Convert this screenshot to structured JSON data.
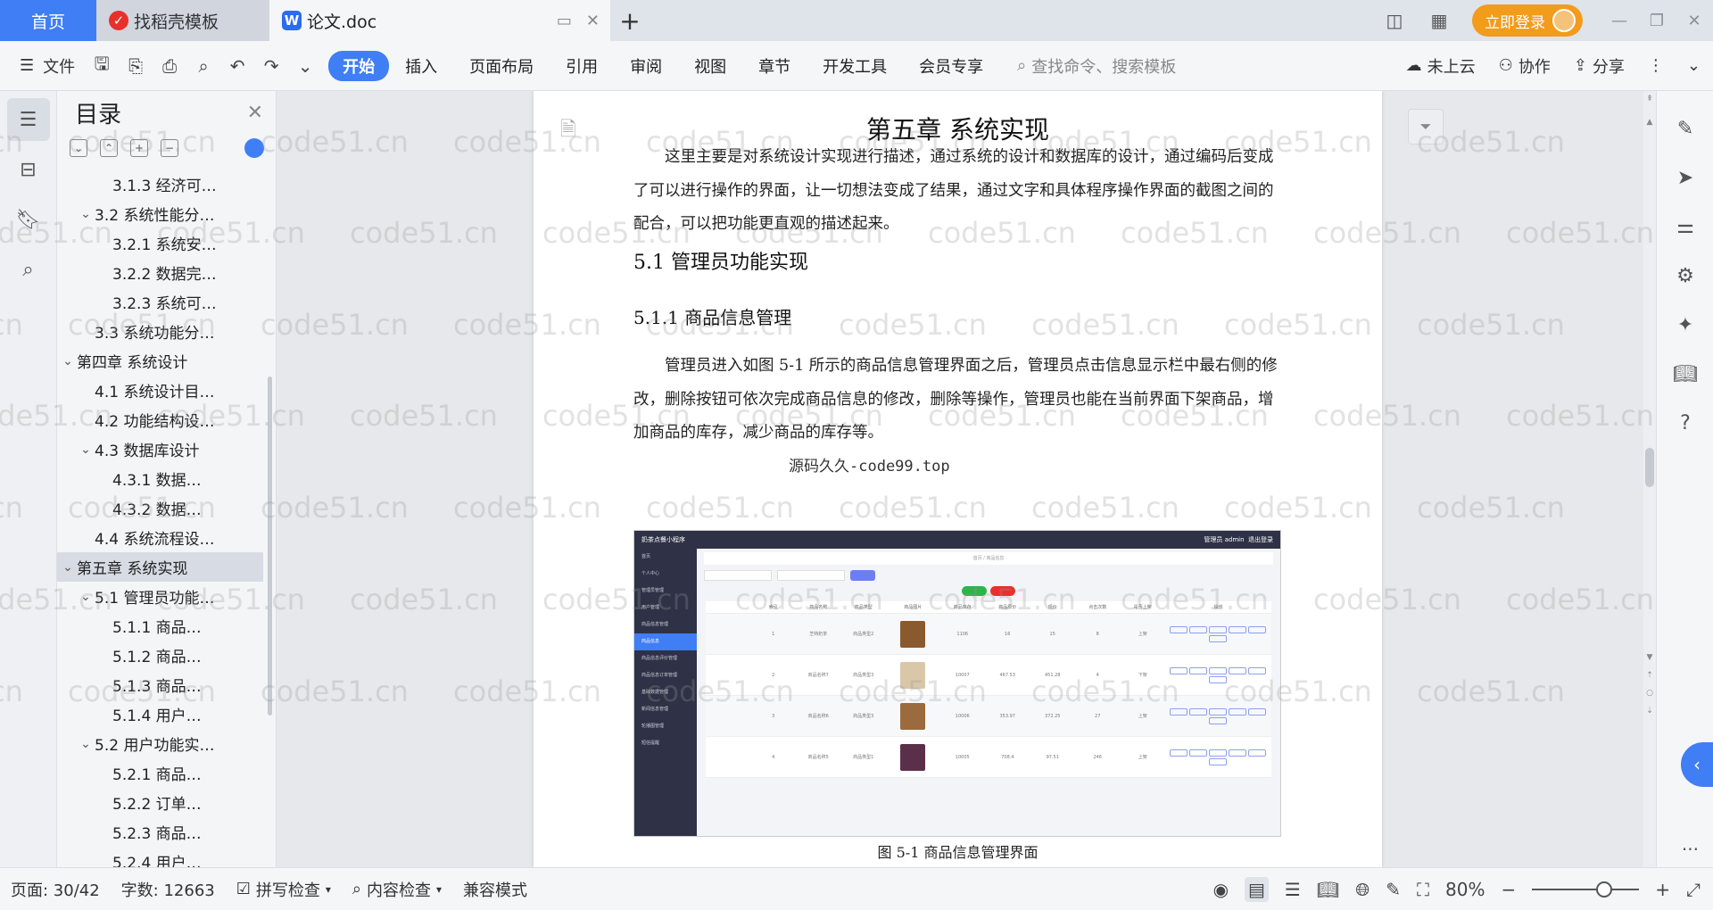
{
  "tabs": {
    "home": "首页",
    "docer": "找稻壳模板",
    "doc": "论文.doc",
    "add": "+"
  },
  "title_right": {
    "login": "立即登录"
  },
  "ribbon": {
    "file": "文件",
    "menus": [
      "开始",
      "插入",
      "页面布局",
      "引用",
      "审阅",
      "视图",
      "章节",
      "开发工具",
      "会员专享"
    ],
    "search_placeholder": "查找命令、搜索模板",
    "cloud": "未上云",
    "collab": "协作",
    "share": "分享"
  },
  "toc": {
    "title": "目录",
    "items": [
      {
        "label": "3.1.3 经济可…",
        "level": 3
      },
      {
        "label": "3.2 系统性能分…",
        "level": 2,
        "arrow": "v"
      },
      {
        "label": "3.2.1 系统安…",
        "level": 3
      },
      {
        "label": "3.2.2 数据完…",
        "level": 3
      },
      {
        "label": "3.2.3 系统可…",
        "level": 3
      },
      {
        "label": "3.3 系统功能分…",
        "level": 2
      },
      {
        "label": "第四章 系统设计",
        "level": 1,
        "arrow": "v"
      },
      {
        "label": "4.1 系统设计目…",
        "level": 2
      },
      {
        "label": "4.2 功能结构设…",
        "level": 2
      },
      {
        "label": "4.3 数据库设计",
        "level": 2,
        "arrow": "v"
      },
      {
        "label": "4.3.1 数据…",
        "level": 3
      },
      {
        "label": "4.3.2 数据…",
        "level": 3
      },
      {
        "label": "4.4 系统流程设…",
        "level": 2
      },
      {
        "label": "第五章 系统实现",
        "level": 1,
        "arrow": "v",
        "selected": true
      },
      {
        "label": "5.1 管理员功能…",
        "level": 2,
        "arrow": "v"
      },
      {
        "label": "5.1.1 商品…",
        "level": 3
      },
      {
        "label": "5.1.2 商品…",
        "level": 3
      },
      {
        "label": "5.1.3 商品…",
        "level": 3
      },
      {
        "label": "5.1.4 用户…",
        "level": 3
      },
      {
        "label": "5.2 用户功能实…",
        "level": 2,
        "arrow": "v"
      },
      {
        "label": "5.2.1 商品…",
        "level": 3
      },
      {
        "label": "5.2.2 订单…",
        "level": 3
      },
      {
        "label": "5.2.3 商品…",
        "level": 3
      },
      {
        "label": "5.2.4 用户…",
        "level": 3
      }
    ]
  },
  "document": {
    "chapter_title": "第五章  系统实现",
    "intro": "这里主要是对系统设计实现进行描述，通过系统的设计和数据库的设计，通过编码后变成了可以进行操作的界面，让一切想法变成了结果，通过文字和具体程序操作界面的截图之间的配合，可以把功能更直观的描述起来。",
    "h2": "5.1 管理员功能实现",
    "h3": "5.1.1  商品信息管理",
    "body": "管理员进入如图 5-1 所示的商品信息管理界面之后，管理员点击信息显示栏中最右侧的修改，删除按钮可依次完成商品信息的修改，删除等操作，管理员也能在当前界面下架商品，增加商品的库存，减少商品的库存等。",
    "overlay_watermark": "源码久久-code99.top",
    "caption": "图 5-1  商品信息管理界面"
  },
  "embedded_screenshot": {
    "app_title": "奶茶点餐小程序",
    "admin": "管理员 admin",
    "logout": "退出登录",
    "crumb": "首页 / 商品信息",
    "side_items": [
      "首页",
      "个人中心",
      "管理员管理",
      "用户管理",
      "商品信息管理",
      "商品信息",
      "商品信息评价管理",
      "商品信息订单管理",
      "基础数据管理",
      "新闻信息管理",
      "轮播图管理",
      "短信提醒"
    ],
    "side_active_index": 5,
    "headers": [
      "",
      "索引",
      "商品名称",
      "商品类型",
      "商品图片",
      "商品库存",
      "商品原价",
      "现价",
      "点击次数",
      "是否上架",
      "操作"
    ],
    "rows": [
      {
        "idx": "1",
        "name": "芝特奶茶",
        "type": "商品类型2",
        "stock": "1106",
        "price": "16",
        "now": "15",
        "clicks": "8",
        "status": "上架",
        "color": "#8a5a2f"
      },
      {
        "idx": "2",
        "name": "商品名称7",
        "type": "商品类型3",
        "stock": "10007",
        "price": "467.53",
        "now": "451.28",
        "clicks": "4",
        "status": "下架",
        "color": "#d9c7a8"
      },
      {
        "idx": "3",
        "name": "商品名称6",
        "type": "商品类型3",
        "stock": "10006",
        "price": "353.97",
        "now": "372.25",
        "clicks": "27",
        "status": "上架",
        "color": "#9b6a3d"
      },
      {
        "idx": "4",
        "name": "商品名称5",
        "type": "商品类型1",
        "stock": "10005",
        "price": "708.4",
        "now": "97.51",
        "clicks": "246",
        "status": "上架",
        "color": "#5b2f4a"
      }
    ]
  },
  "watermark": "code51.cn",
  "status": {
    "page": "页面: 30/42",
    "words": "字数: 12663",
    "spell": "拼写检查",
    "content": "内容检查",
    "compat": "兼容模式",
    "zoom": "80%"
  }
}
